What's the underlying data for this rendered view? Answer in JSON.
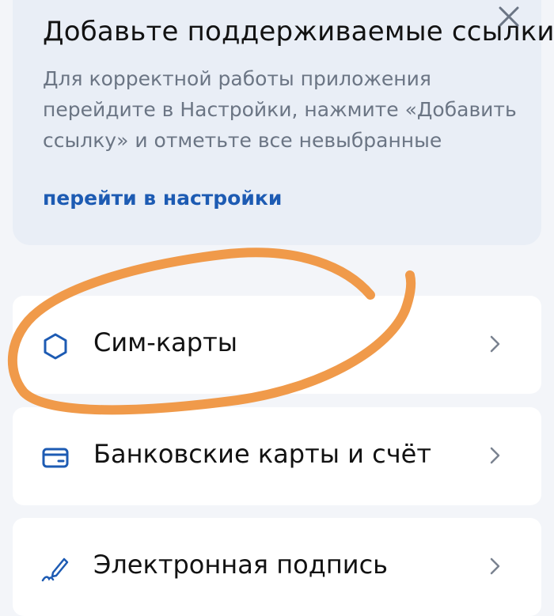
{
  "banner": {
    "title": "Добавьте поддерживаемые ссылки",
    "text": "Для корректной работы приложения перейдите в Настройки, нажмите «Добавить ссылку» и отметьте все невыбранные",
    "link": "перейти в настройки",
    "close_icon": "close-icon"
  },
  "menu": {
    "items": [
      {
        "label": "Сим-карты",
        "icon": "hexagon-icon"
      },
      {
        "label": "Банковские карты и счёт",
        "icon": "bank-card-icon"
      },
      {
        "label": "Электронная подпись",
        "icon": "signature-pen-icon"
      }
    ]
  },
  "colors": {
    "accent": "#1d5bb3",
    "annotation": "#f09a4a",
    "background": "#f3f5f9"
  }
}
